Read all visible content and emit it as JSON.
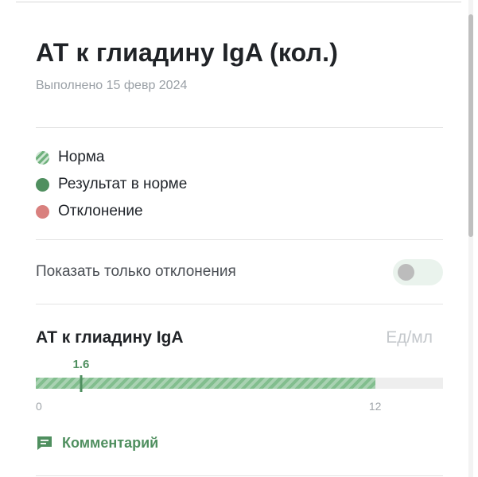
{
  "header": {
    "title": "АТ к глиадину IgA (кол.)",
    "date": "Выполнено 15 февр 2024"
  },
  "legend": [
    {
      "label": "Норма",
      "icon": "striped-dot-icon",
      "color": "#6fb17c"
    },
    {
      "label": "Результат в норме",
      "icon": "dot-icon",
      "color": "#4f8f5f"
    },
    {
      "label": "Отклонение",
      "icon": "dot-icon",
      "color": "#d9807e"
    }
  ],
  "filter": {
    "label": "Показать только отклонения",
    "enabled": false
  },
  "result": {
    "name": "АТ к глиадину IgA",
    "unit": "Ед/мл",
    "value": "1.6",
    "value_num": 1.6,
    "range_min": "0",
    "range_max": "12",
    "scale_max": 14.4
  },
  "comment": {
    "label": "Комментарий",
    "icon": "comment-icon"
  },
  "colors": {
    "accent": "#4f8f5f",
    "norm_fill": "#82be8e",
    "deviation": "#d9807e"
  }
}
